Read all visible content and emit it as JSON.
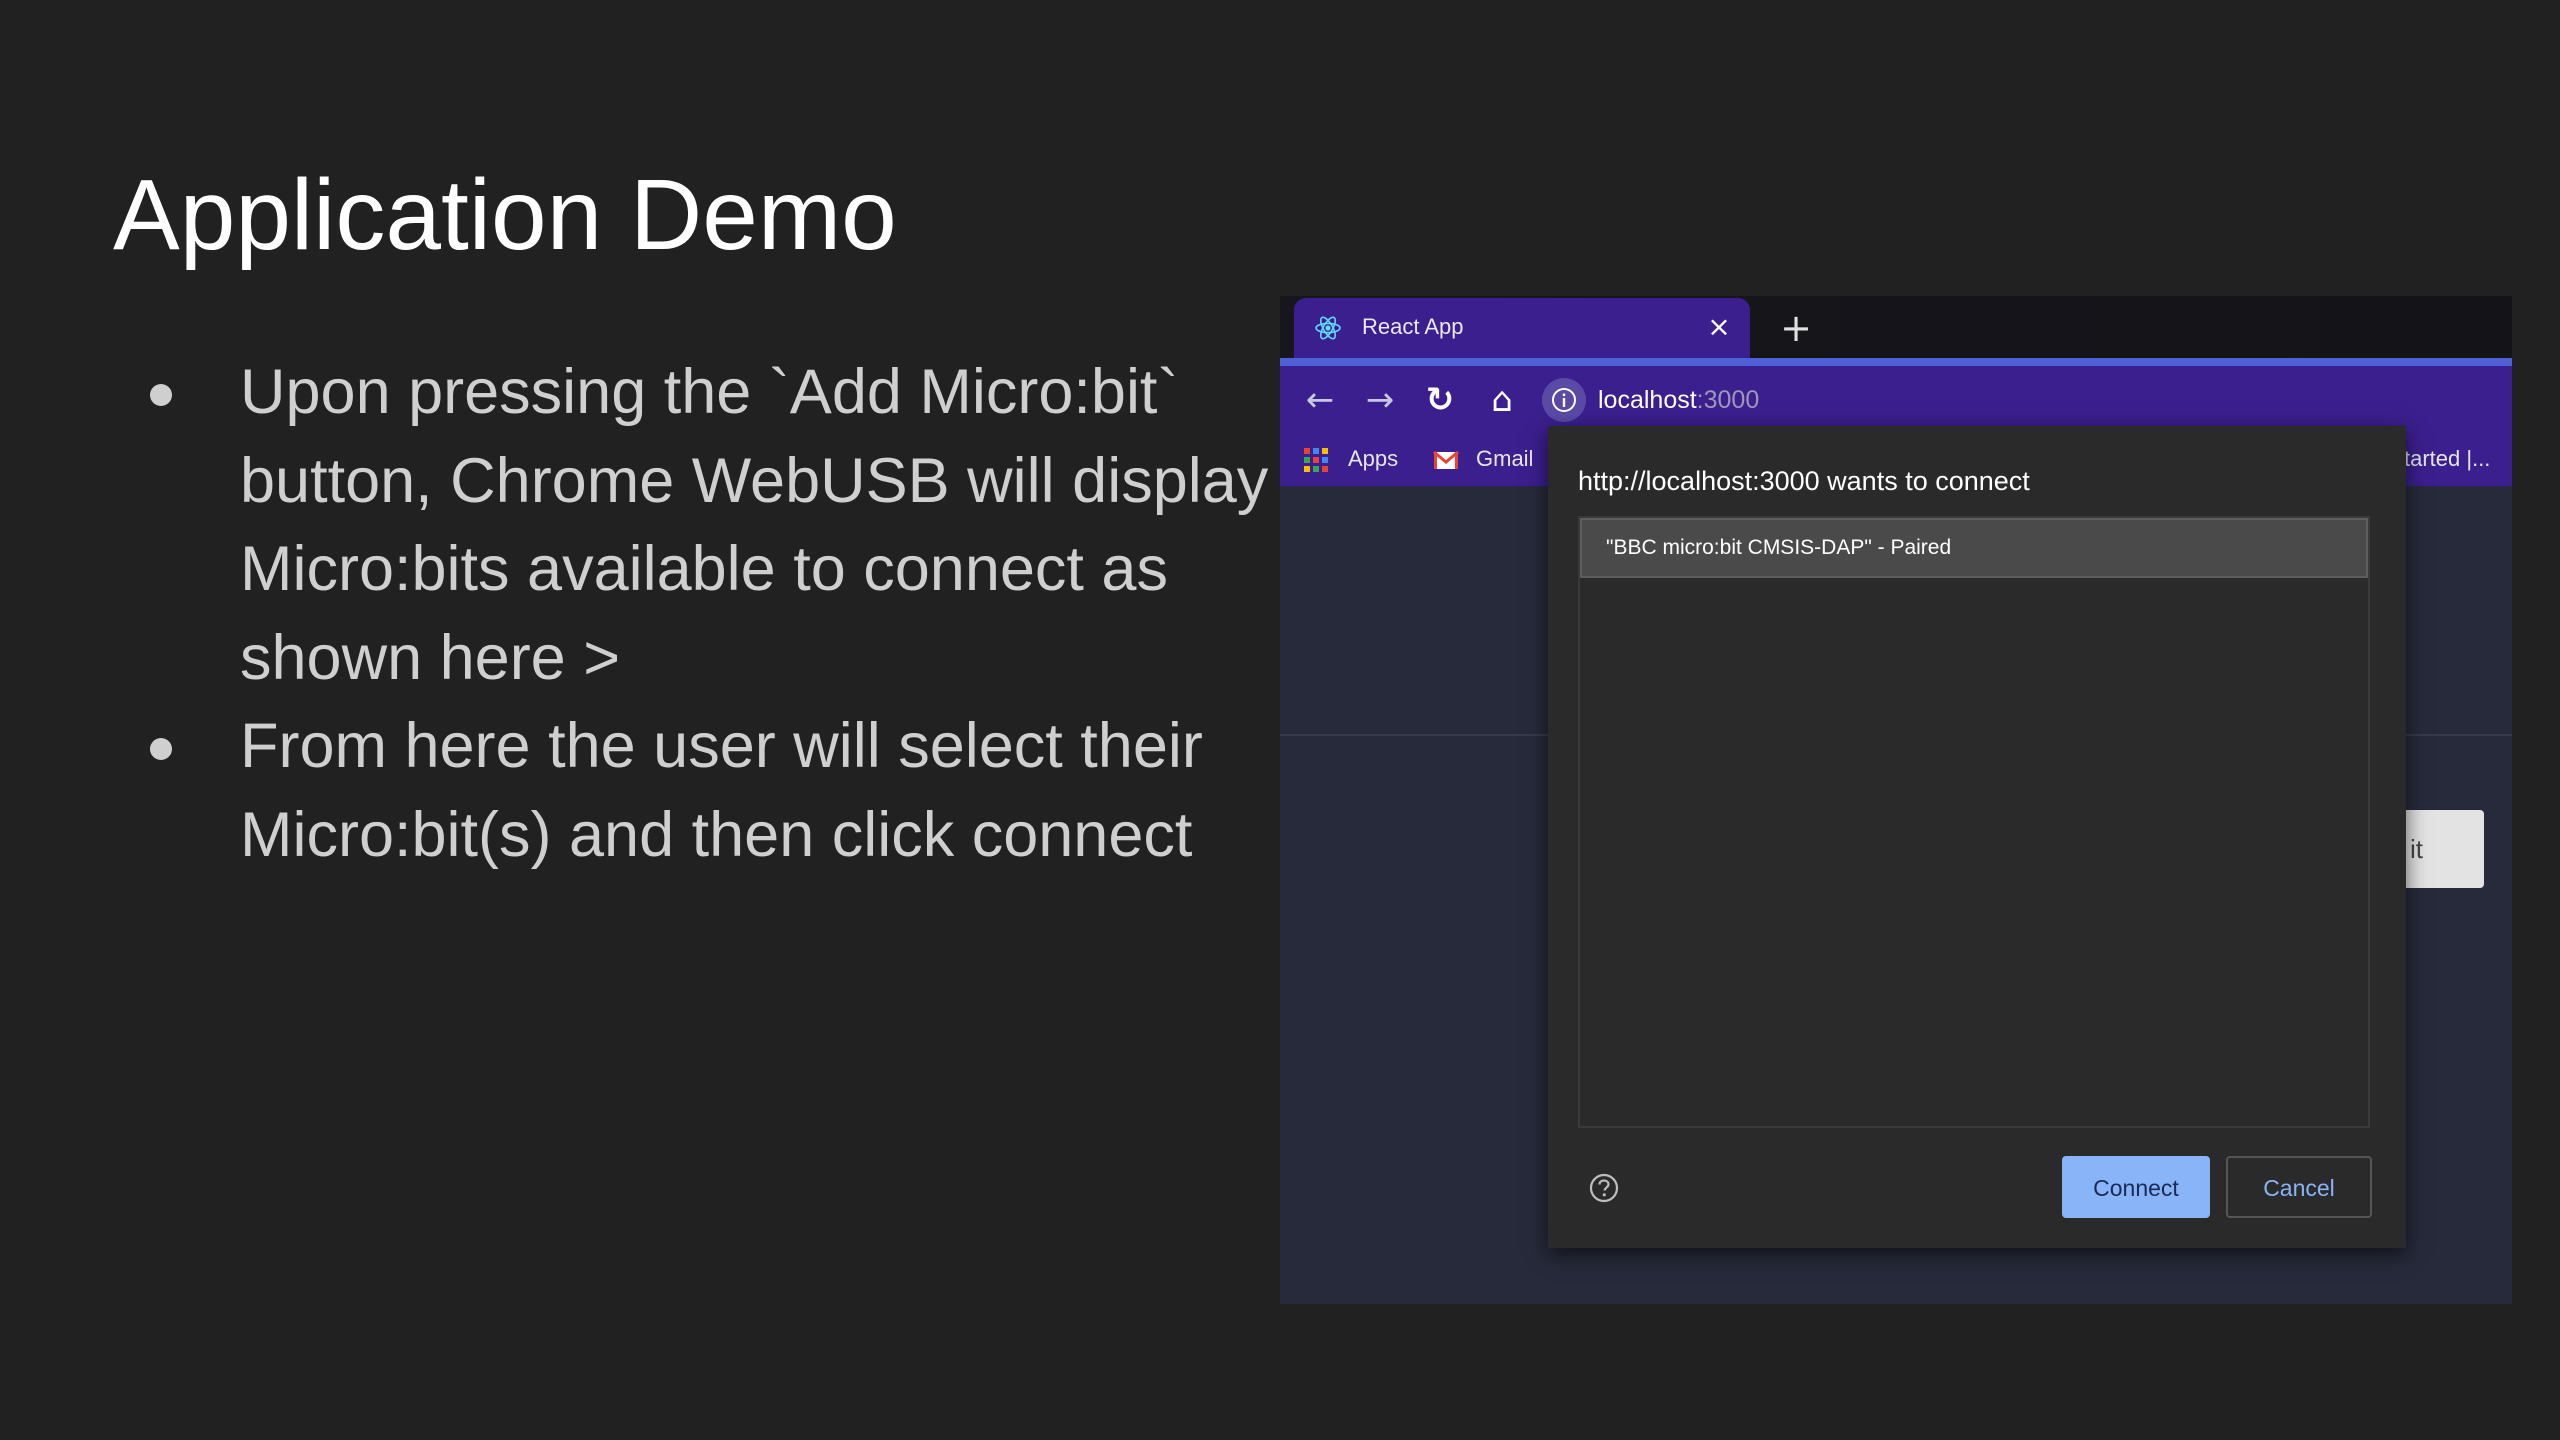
{
  "slide": {
    "title": "Application Demo",
    "bullets": [
      "Upon pressing the `Add Micro:bit` button, Chrome WebUSB will display Micro:bits available to connect as shown here >",
      "From here the user will select their Micro:bit(s) and then click connect"
    ]
  },
  "browser": {
    "tab": {
      "title": "React App",
      "close_label": "×",
      "icon": "react-logo-icon"
    },
    "new_tab_label": "+",
    "address": {
      "host": "localhost",
      "port": ":3000"
    },
    "bookmarks": [
      {
        "label": "Apps",
        "icon": "apps-grid-icon"
      },
      {
        "label": "Gmail",
        "icon": "gmail-icon"
      },
      {
        "label": "tarted |..."
      }
    ],
    "page_button_fragment": "it"
  },
  "dialog": {
    "title": "http://localhost:3000 wants to connect",
    "devices": [
      "\"BBC micro:bit CMSIS-DAP\" - Paired"
    ],
    "connect_label": "Connect",
    "cancel_label": "Cancel",
    "help_icon": "help-circle-icon"
  },
  "colors": {
    "slide_background": "#212121",
    "browser_theme": "#3b1f8e",
    "accent_blue": "#8ab4f8"
  }
}
